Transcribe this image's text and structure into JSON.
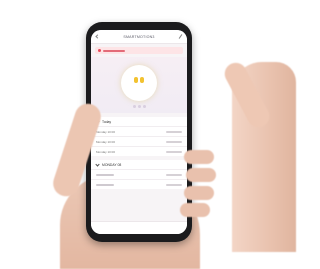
{
  "app": {
    "title": "SMARTMOTION3"
  },
  "alert": {
    "icon": "alert-dot-icon",
    "color": "#e94b5b"
  },
  "hero": {
    "icon": "light-bulbs-icon",
    "accent": "#f2c230"
  },
  "sections": [
    {
      "label": "Today",
      "rows": [
        {
          "left": "Monday 10:00",
          "right": ""
        },
        {
          "left": "Monday 10:00",
          "right": ""
        },
        {
          "left": "Monday 10:00",
          "right": ""
        }
      ]
    },
    {
      "label": "MONDAY 08",
      "rows": [
        {
          "left": "",
          "right": ""
        },
        {
          "left": "",
          "right": ""
        }
      ]
    }
  ]
}
